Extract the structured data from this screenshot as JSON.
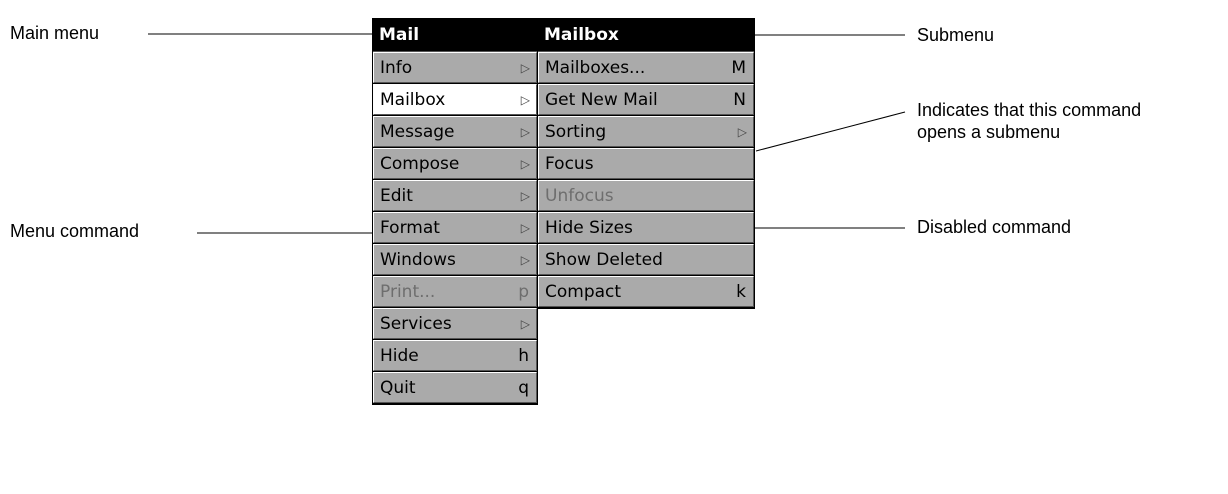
{
  "callouts": {
    "main_menu": "Main menu",
    "menu_command": "Menu command",
    "submenu": "Submenu",
    "submenu_indicator_line1": "Indicates that this command",
    "submenu_indicator_line2": "opens a submenu",
    "disabled_command": "Disabled command"
  },
  "main_menu": {
    "title": "Mail",
    "items": [
      {
        "label": "Info",
        "key": "",
        "submenu": true,
        "disabled": false,
        "selected": false
      },
      {
        "label": "Mailbox",
        "key": "",
        "submenu": true,
        "disabled": false,
        "selected": true
      },
      {
        "label": "Message",
        "key": "",
        "submenu": true,
        "disabled": false,
        "selected": false
      },
      {
        "label": "Compose",
        "key": "",
        "submenu": true,
        "disabled": false,
        "selected": false
      },
      {
        "label": "Edit",
        "key": "",
        "submenu": true,
        "disabled": false,
        "selected": false
      },
      {
        "label": "Format",
        "key": "",
        "submenu": true,
        "disabled": false,
        "selected": false
      },
      {
        "label": "Windows",
        "key": "",
        "submenu": true,
        "disabled": false,
        "selected": false
      },
      {
        "label": "Print...",
        "key": "p",
        "submenu": false,
        "disabled": true,
        "selected": false
      },
      {
        "label": "Services",
        "key": "",
        "submenu": true,
        "disabled": false,
        "selected": false
      },
      {
        "label": "Hide",
        "key": "h",
        "submenu": false,
        "disabled": false,
        "selected": false
      },
      {
        "label": "Quit",
        "key": "q",
        "submenu": false,
        "disabled": false,
        "selected": false
      }
    ]
  },
  "submenu": {
    "title": "Mailbox",
    "items": [
      {
        "label": "Mailboxes...",
        "key": "M",
        "submenu": false,
        "disabled": false,
        "selected": false
      },
      {
        "label": "Get New Mail",
        "key": "N",
        "submenu": false,
        "disabled": false,
        "selected": false
      },
      {
        "label": "Sorting",
        "key": "",
        "submenu": true,
        "disabled": false,
        "selected": false
      },
      {
        "label": "Focus",
        "key": "",
        "submenu": false,
        "disabled": false,
        "selected": false
      },
      {
        "label": "Unfocus",
        "key": "",
        "submenu": false,
        "disabled": true,
        "selected": false
      },
      {
        "label": "Hide Sizes",
        "key": "",
        "submenu": false,
        "disabled": false,
        "selected": false
      },
      {
        "label": "Show Deleted",
        "key": "",
        "submenu": false,
        "disabled": false,
        "selected": false
      },
      {
        "label": "Compact",
        "key": "k",
        "submenu": false,
        "disabled": false,
        "selected": false
      }
    ]
  },
  "icons": {
    "submenu_arrow": "submenu-arrow-icon"
  },
  "colors": {
    "menu_item_bg": "#aaaaaa",
    "menu_title_bg": "#000000",
    "selected_bg": "#ffffff",
    "disabled_text": "#6e6e6e"
  }
}
